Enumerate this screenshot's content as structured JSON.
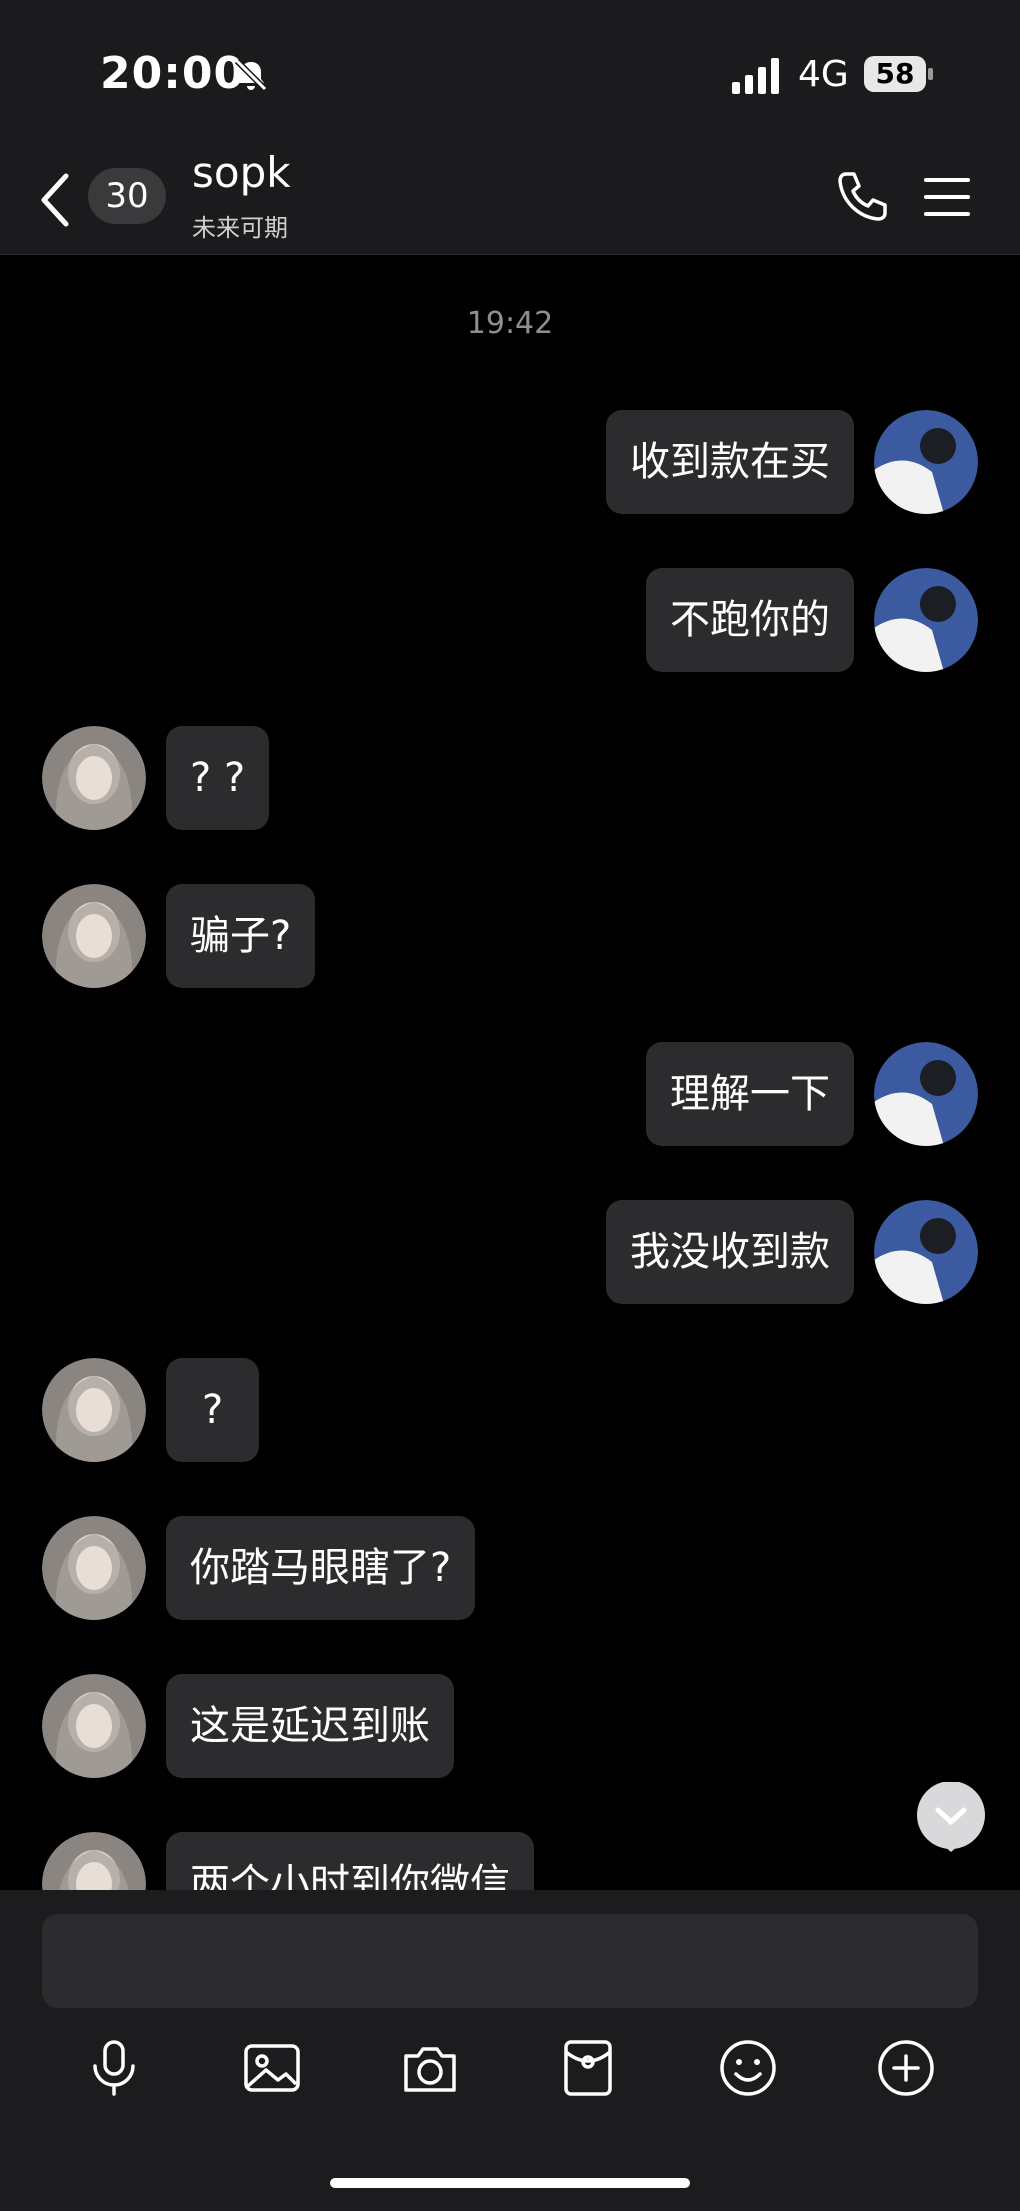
{
  "status_bar": {
    "time": "20:00",
    "network": "4G",
    "battery": "58",
    "icons": [
      "bell-muted-icon",
      "signal-icon",
      "battery-icon"
    ]
  },
  "header": {
    "back_icon": "chevron-left-icon",
    "unread_count": "30",
    "title": "sopk",
    "subtitle": "未来可期",
    "call_icon": "phone-icon",
    "menu_icon": "hamburger-menu-icon"
  },
  "chat": {
    "timestamp": "19:42",
    "messages": [
      {
        "side": "out",
        "text": "收到款在买"
      },
      {
        "side": "out",
        "text": "不跑你的"
      },
      {
        "side": "in",
        "text": "? ?"
      },
      {
        "side": "in",
        "text": "骗子?"
      },
      {
        "side": "out",
        "text": "理解一下"
      },
      {
        "side": "out",
        "text": "我没收到款"
      },
      {
        "side": "in",
        "text": " ? "
      },
      {
        "side": "in",
        "text": "你踏马眼瞎了?"
      },
      {
        "side": "in",
        "text": "这是延迟到账"
      },
      {
        "side": "in",
        "text": "两个小时到你微信"
      }
    ],
    "scroll_down_icon": "chevron-down-circle-icon"
  },
  "composer": {
    "input_value": "",
    "tools": [
      "microphone-icon",
      "image-icon",
      "camera-icon",
      "red-packet-icon",
      "emoji-icon",
      "plus-circle-icon"
    ]
  },
  "colors": {
    "background": "#000000",
    "bar": "#1b1b1d",
    "bubble": "#2c2c2e",
    "timestamp": "#8e8e93"
  }
}
